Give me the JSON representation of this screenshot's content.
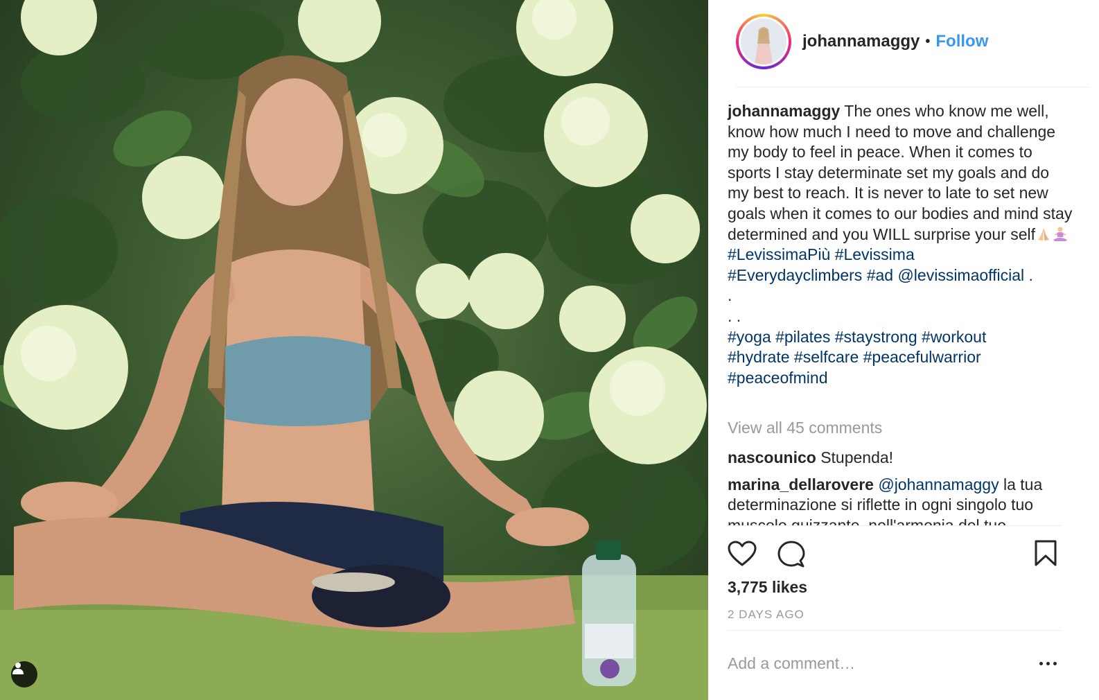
{
  "post": {
    "photo_icon": "person-tag-icon"
  },
  "header": {
    "username": "johannamaggy",
    "separator": "•",
    "follow_label": "Follow"
  },
  "caption": {
    "username": "johannamaggy",
    "text": "The ones who know me well, know how much I need to move and challenge my body to feel in peace. When it comes to sports I stay determinate set my goals and do my best to reach. It is never to late to set new goals when it comes to our bodies and mind stay determined and you WILL surprise your self",
    "emojis": [
      "folded-hands-emoji",
      "person-in-lotus-position-emoji"
    ],
    "tags_line1": [
      "#LevissimaPiù",
      "#Levissima"
    ],
    "tags_line2": [
      "#Everydayclimbers",
      "#ad",
      "@levissimaofficial"
    ],
    "trailing_dot": ".",
    "dot_line1": ".",
    "dot_line2": ". .",
    "hashtags": [
      "#yoga",
      "#pilates",
      "#staystrong",
      "#workout",
      "#hydrate",
      "#selfcare",
      "#peacefulwarrior",
      "#peaceofmind"
    ]
  },
  "view_all_comments": "View all 45 comments",
  "comments": [
    {
      "username": "nascounico",
      "text": "Stupenda!"
    },
    {
      "username": "marina_dellarovere",
      "mention": "@johannamaggy",
      "text": "la tua determinazione si riflette in ogni singolo tuo muscolo guizzante, nell'armonia del tuo"
    }
  ],
  "actions": {
    "like_icon": "heart-icon",
    "comment_icon": "comment-bubble-icon",
    "save_icon": "bookmark-icon"
  },
  "likes": "3,775 likes",
  "time": "2 DAYS AGO",
  "add_comment": {
    "placeholder": "Add a comment…"
  },
  "more_icon": "more-options-icon",
  "colors": {
    "link": "#003569",
    "follow": "#3897f0",
    "muted": "#999999",
    "text": "#262626"
  }
}
